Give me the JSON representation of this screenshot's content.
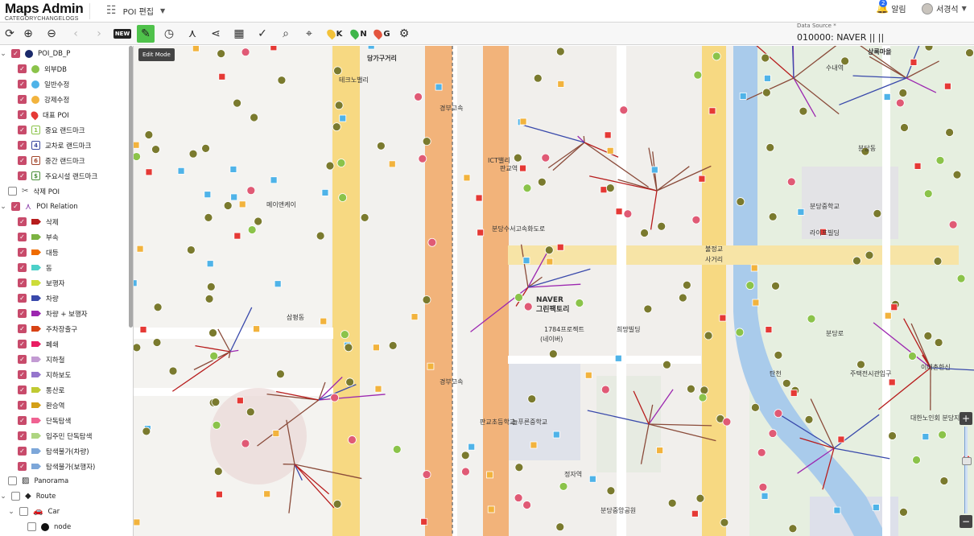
{
  "app": {
    "title": "Maps Admin",
    "subtitle": "CATEGORYCHANGELOGS"
  },
  "menu": {
    "poi_edit": "POI 편집"
  },
  "header_right": {
    "alarm_label": "알림",
    "alarm_count": "2",
    "user_name": "서경석"
  },
  "toolbar": {
    "keys": {
      "k": "K",
      "n": "N",
      "g": "G"
    },
    "key_colors": {
      "k": "#f3c23a",
      "n": "#3fb64a",
      "g": "#e4553e"
    },
    "data_source_label": "Data Source *",
    "data_source_value": "010000: NAVER || ||"
  },
  "tooltip": "Edit Mode",
  "sidebar": {
    "poi_db": {
      "label": "POI_DB_P",
      "color": "#1b2a6b"
    },
    "poi_items": [
      {
        "label": "외부DB",
        "color": "#8bc34a"
      },
      {
        "label": "일반수정",
        "color": "#4fb3e8"
      },
      {
        "label": "강제수정",
        "color": "#f2b33d"
      },
      {
        "label": "대표 POI",
        "color": "#e53935"
      },
      {
        "label": "중요 랜드마크",
        "color": "#8bc34a",
        "icon": "1"
      },
      {
        "label": "교차로 랜드마크",
        "color": "#3b4aa0",
        "icon": "4"
      },
      {
        "label": "중간 랜드마크",
        "color": "#a1452b",
        "icon": "6"
      },
      {
        "label": "주요시설 랜드마크",
        "color": "#4a8f3a",
        "icon": "$"
      }
    ],
    "deleted_poi": "삭제 POI",
    "relation": {
      "label": "POI Relation",
      "color": "#8e44ad"
    },
    "relation_items": [
      {
        "label": "삭제",
        "color": "#b71c1c"
      },
      {
        "label": "부속",
        "color": "#7cb342"
      },
      {
        "label": "대등",
        "color": "#ef6c00"
      },
      {
        "label": "동",
        "color": "#4dd0c9"
      },
      {
        "label": "보행자",
        "color": "#cddc39"
      },
      {
        "label": "차량",
        "color": "#3949ab"
      },
      {
        "label": "차량 + 보행자",
        "color": "#9c27b0"
      },
      {
        "label": "주차장출구",
        "color": "#d84315"
      },
      {
        "label": "폐쇄",
        "color": "#e91e63"
      },
      {
        "label": "지하철",
        "color": "#c39bd3"
      },
      {
        "label": "지하보도",
        "color": "#9575cd"
      },
      {
        "label": "통산로",
        "color": "#c0ca33"
      },
      {
        "label": "환승역",
        "color": "#d4a017"
      },
      {
        "label": "단독탐색",
        "color": "#f06292"
      },
      {
        "label": "입주민 단독탐색",
        "color": "#aed581"
      },
      {
        "label": "탐색불가(차량)",
        "color": "#7da7d9"
      },
      {
        "label": "탐색불가(보행자)",
        "color": "#7da7d9"
      }
    ],
    "panorama": "Panorama",
    "route": "Route",
    "car": "Car",
    "node": "node"
  },
  "map": {
    "labels": [
      {
        "text": "당가구거리"
      },
      {
        "text": "경부고속"
      },
      {
        "text": "경부고속"
      },
      {
        "text": "테크노밸리"
      },
      {
        "text": "분당수서고속화도로"
      },
      {
        "text": "판교역"
      },
      {
        "text": "삼평동"
      },
      {
        "text": "ICT밸리"
      },
      {
        "text": "메이앤케이"
      },
      {
        "text": "NAVER"
      },
      {
        "text": "그린팩토리"
      },
      {
        "text": "1784프로젝트"
      },
      {
        "text": "(네이버)"
      },
      {
        "text": "불정교"
      },
      {
        "text": "사거리"
      },
      {
        "text": "상록마을"
      },
      {
        "text": "분당중학교"
      },
      {
        "text": "탄천"
      },
      {
        "text": "수내역"
      },
      {
        "text": "분당동"
      },
      {
        "text": "주택전시관입구"
      },
      {
        "text": "라이프빌딩"
      },
      {
        "text": "분당로"
      },
      {
        "text": "대한노인회 분당지회"
      },
      {
        "text": "이매촌한신"
      },
      {
        "text": "판교초등학교"
      },
      {
        "text": "늘푸른중학교"
      },
      {
        "text": "정자역"
      },
      {
        "text": "분당중앙공원"
      },
      {
        "text": "희망빌딩"
      }
    ]
  }
}
